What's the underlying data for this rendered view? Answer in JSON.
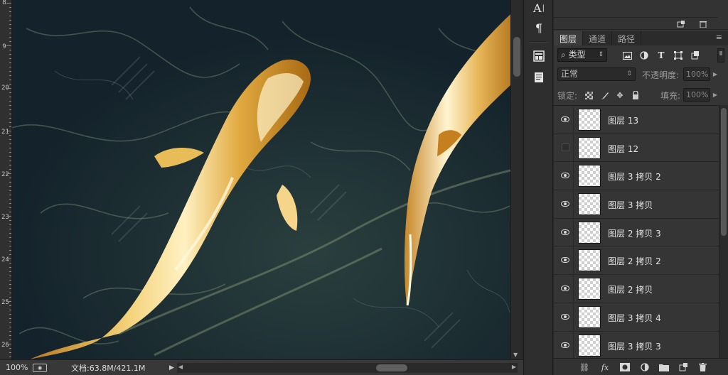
{
  "ruler": {
    "labels": [
      "8",
      "9",
      "20",
      "21",
      "22",
      "23",
      "24",
      "25",
      "26"
    ]
  },
  "statusbar": {
    "zoom": "100%",
    "doc_info": "文档:63.8M/421.1M"
  },
  "toolbar": {
    "items": [
      "character-icon",
      "paragraph-icon",
      "properties-icon",
      "notes-icon"
    ]
  },
  "panel": {
    "tabs": [
      "图层",
      "通道",
      "路径"
    ],
    "active_tab": "图层",
    "filter": {
      "kind_label": "类型"
    },
    "blend": {
      "mode": "正常",
      "opacity_label": "不透明度:",
      "opacity_value": "100%"
    },
    "lock": {
      "lock_label": "锁定:",
      "fill_label": "填充:",
      "fill_value": "100%"
    },
    "layers": [
      {
        "name": "图层 13",
        "visible": true
      },
      {
        "name": "图层 12",
        "visible": false
      },
      {
        "name": "图层 3 拷贝 2",
        "visible": true
      },
      {
        "name": "图层 3 拷贝",
        "visible": true
      },
      {
        "name": "图层 2 拷贝 3",
        "visible": true
      },
      {
        "name": "图层 2 拷贝 2",
        "visible": true
      },
      {
        "name": "图层 2 拷贝",
        "visible": true
      },
      {
        "name": "图层 3 拷贝 4",
        "visible": true
      },
      {
        "name": "图层 3 拷贝 3",
        "visible": true
      }
    ]
  },
  "colors": {
    "canvas_bg": "#1a2b34",
    "fish_gold": "#d9a441",
    "panel_bg": "#353535"
  }
}
